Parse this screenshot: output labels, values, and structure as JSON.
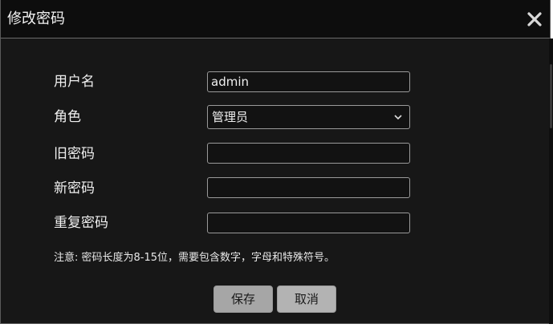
{
  "dialog": {
    "title": "修改密码",
    "close_icon": "close-icon"
  },
  "form": {
    "username": {
      "label": "用户名",
      "value": "admin"
    },
    "role": {
      "label": "角色",
      "value": "管理员"
    },
    "old_password": {
      "label": "旧密码",
      "value": ""
    },
    "new_password": {
      "label": "新密码",
      "value": ""
    },
    "confirm_password": {
      "label": "重复密码",
      "value": ""
    },
    "note": "注意: 密码长度为8-15位，需要包含数字，字母和特殊符号。"
  },
  "buttons": {
    "save_label": "保存",
    "cancel_label": "取消"
  },
  "colors": {
    "background": "#171717",
    "titlebar": "#0d0d0d",
    "button": "#a6a6a6"
  }
}
